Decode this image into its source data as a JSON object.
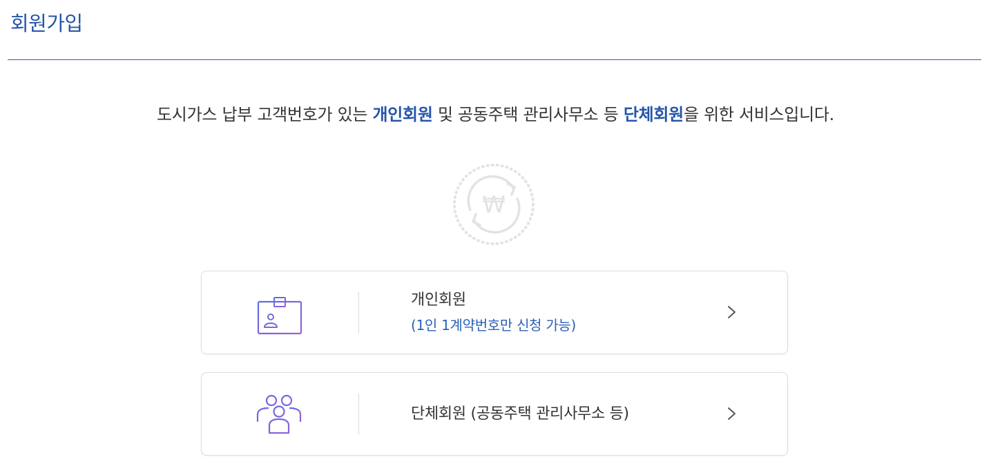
{
  "header": {
    "title": "회원가입"
  },
  "intro": {
    "part1": "도시가스 납부 고객번호가 있는 ",
    "highlight1": "개인회원",
    "part2": " 및 공동주택 관리사무소 등 ",
    "highlight2": "단체회원",
    "part3": "을 위한 서비스입니다."
  },
  "hero": {
    "icon": "won-refresh-icon",
    "symbol": "₩"
  },
  "cards": [
    {
      "label": "개인회원",
      "sublabel": "(1인 1계약번호만 신청 가능)",
      "icon": "id-card-icon"
    },
    {
      "label": "단체회원 (공동주택 관리사무소 등)",
      "icon": "group-icon"
    }
  ],
  "colors": {
    "brand": "#2455a8",
    "icon_gradient_start": "#5b6ee0",
    "icon_gradient_end": "#9a5fd6",
    "border": "#dcdcdc",
    "hero_gray": "#e3e3e3"
  }
}
